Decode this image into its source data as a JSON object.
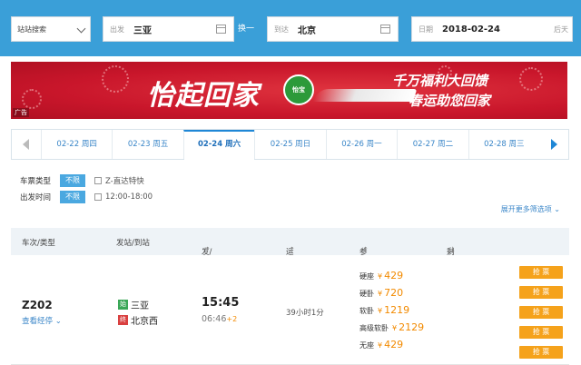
{
  "search": {
    "mode": "站站搜索",
    "from_label": "出发",
    "from_value": "三亚",
    "swap_label": "换一",
    "to_label": "到达",
    "to_value": "北京",
    "date_label": "日期",
    "date_value": "2018-02-24",
    "date_suffix": "后天"
  },
  "banner": {
    "title": "怡起回家",
    "logo_text": "怡宝",
    "slogan_line1": "千万福利大回馈",
    "slogan_line2": "春运助您回家",
    "ad_label": "广告"
  },
  "date_tabs": [
    {
      "label": "02-22 周四"
    },
    {
      "label": "02-23 周五"
    },
    {
      "label": "02-24 周六",
      "active": true
    },
    {
      "label": "02-25 周日"
    },
    {
      "label": "02-26 周一"
    },
    {
      "label": "02-27 周二"
    },
    {
      "label": "02-28 周三"
    }
  ],
  "filters": {
    "type_label": "车票类型",
    "type_pill": "不限",
    "type_option": "Z-直达特快",
    "time_label": "出发时间",
    "time_pill": "不限",
    "time_option": "12:00-18:00",
    "more": "展开更多筛选项"
  },
  "table_header": {
    "col_train": "车次/类型",
    "col_stations": "发站/到站",
    "col_depart": "发/到时间",
    "col_duration": "运行时间",
    "col_price": "参考票价",
    "col_remain": "剩余票量"
  },
  "row": {
    "train_no": "Z202",
    "via_label": "查看经停",
    "from_tag": "始",
    "from_station": "三亚",
    "to_tag": "终",
    "to_station": "北京西",
    "depart_time": "15:45",
    "arrive_time": "06:46",
    "arrive_plus": "+2",
    "duration": "39小时1分",
    "currency": "¥",
    "prices": [
      {
        "seat": "硬座",
        "amount": "429"
      },
      {
        "seat": "硬卧",
        "amount": "720"
      },
      {
        "seat": "软卧",
        "amount": "1219"
      },
      {
        "seat": "高级软卧",
        "amount": "2129"
      },
      {
        "seat": "无座",
        "amount": "429"
      }
    ],
    "buy_label": "抢 票"
  },
  "colors": {
    "topbar": "#3a9fd8",
    "banner": "#c9162b",
    "accent_blue": "#1f87d6",
    "price_orange": "#f28a00",
    "buy_button": "#f5a21b"
  }
}
